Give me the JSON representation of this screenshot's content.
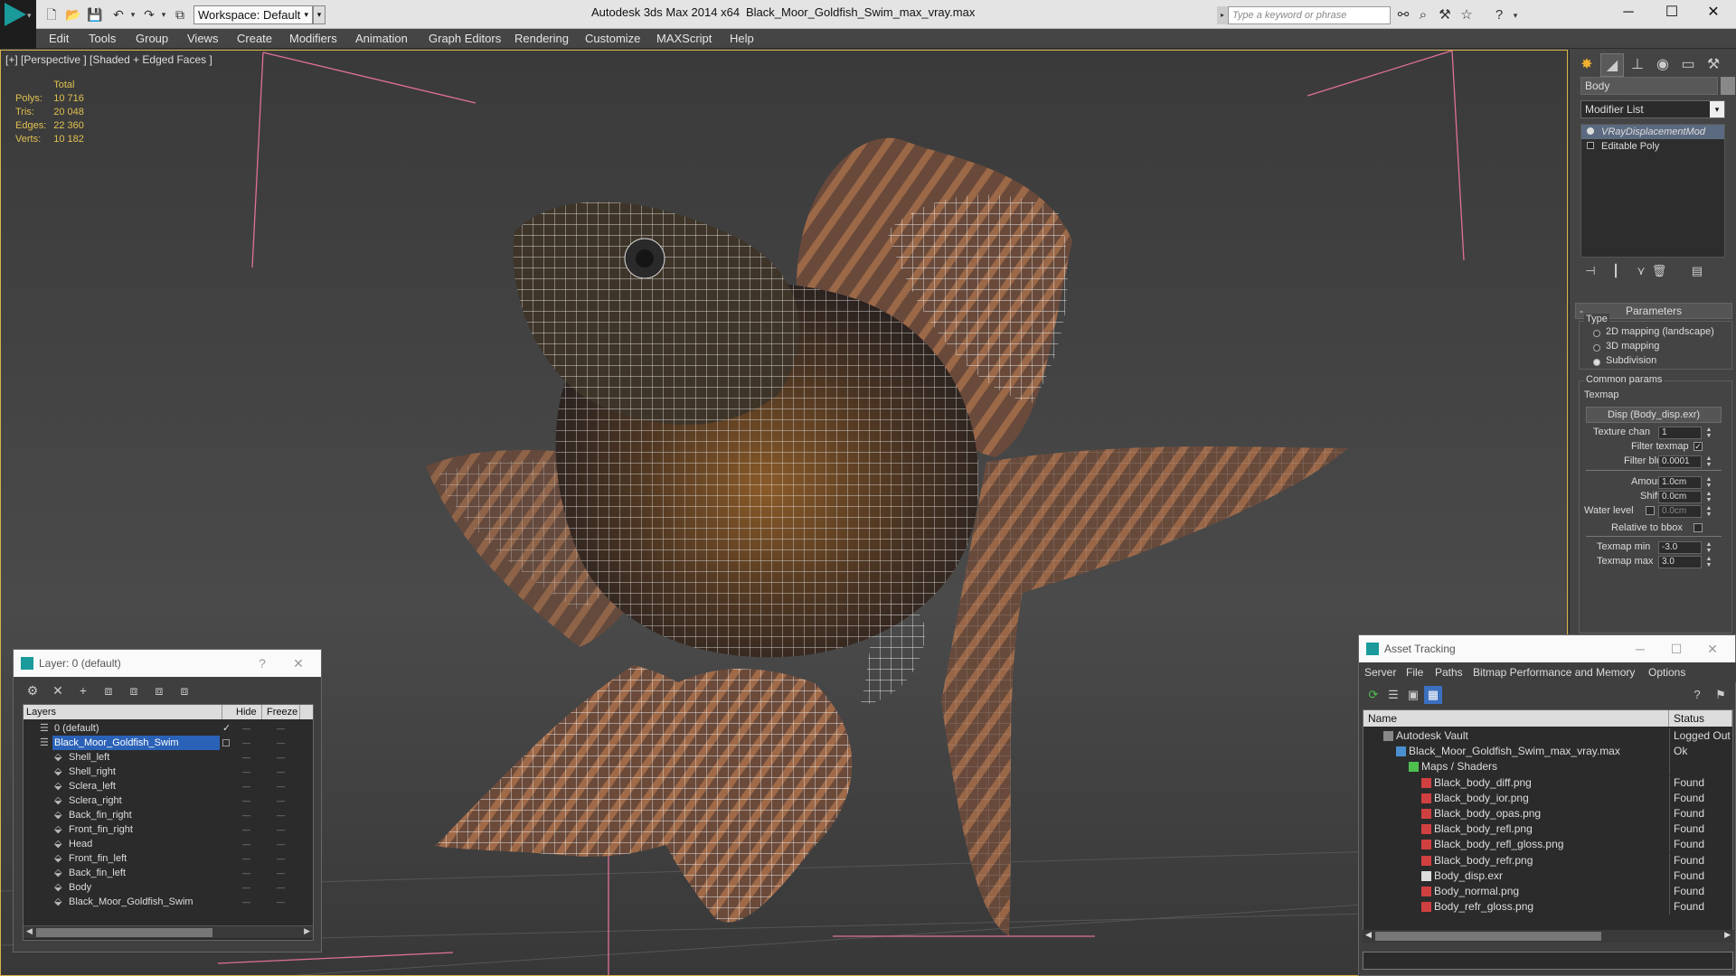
{
  "app": {
    "title": "Autodesk 3ds Max  2014 x64",
    "file": "Black_Moor_Goldfish_Swim_max_vray.max",
    "workspace": "Workspace: Default",
    "search_placeholder": "Type a keyword or phrase"
  },
  "menu": [
    "Edit",
    "Tools",
    "Group",
    "Views",
    "Create",
    "Modifiers",
    "Animation",
    "Graph Editors",
    "Rendering",
    "Customize",
    "MAXScript",
    "Help"
  ],
  "viewport": {
    "label": "[+] [Perspective ] [Shaded + Edged Faces ]",
    "stats": {
      "header": "Total",
      "rows": [
        {
          "label": "Polys:",
          "value": "10 716"
        },
        {
          "label": "Tris:",
          "value": "20 048"
        },
        {
          "label": "Edges:",
          "value": "22 360"
        },
        {
          "label": "Verts:",
          "value": "10 182"
        }
      ]
    }
  },
  "command_panel": {
    "object_name": "Body",
    "modifier_list": "Modifier List",
    "stack": [
      "VRayDisplacementMod",
      "Editable Poly"
    ],
    "rollout": "Parameters",
    "type_label": "Type",
    "types": [
      {
        "label": "2D mapping (landscape)",
        "on": false
      },
      {
        "label": "3D mapping",
        "on": false
      },
      {
        "label": "Subdivision",
        "on": true
      }
    ],
    "common_label": "Common params",
    "texmap_label": "Texmap",
    "texmap_button": "Disp (Body_disp.exr)",
    "texture_chan_label": "Texture chan",
    "texture_chan": "1",
    "filter_texmap_label": "Filter texmap",
    "filter_blur_label": "Filter blur",
    "filter_blur": "0.0001",
    "amount_label": "Amount",
    "amount": "1.0cm",
    "shift_label": "Shift",
    "shift": "0.0cm",
    "water_label": "Water level",
    "water": "0.0cm",
    "rel_bbox_label": "Relative to bbox",
    "texmap_min_label": "Texmap min",
    "texmap_min": "-3.0",
    "texmap_max_label": "Texmap max",
    "texmap_max": "3.0"
  },
  "layer_dialog": {
    "title": "Layer: 0 (default)",
    "help": "?",
    "close": "✕",
    "columns": [
      "Layers",
      "Hide",
      "Freeze"
    ],
    "rows": [
      {
        "name": "0 (default)",
        "indent": 0,
        "check": true
      },
      {
        "name": "Black_Moor_Goldfish_Swim",
        "indent": 0,
        "selected": true
      },
      {
        "name": "Shell_left",
        "indent": 1
      },
      {
        "name": "Shell_right",
        "indent": 1
      },
      {
        "name": "Sclera_left",
        "indent": 1
      },
      {
        "name": "Sclera_right",
        "indent": 1
      },
      {
        "name": "Back_fin_right",
        "indent": 1
      },
      {
        "name": "Front_fin_right",
        "indent": 1
      },
      {
        "name": "Head",
        "indent": 1
      },
      {
        "name": "Front_fin_left",
        "indent": 1
      },
      {
        "name": "Back_fin_left",
        "indent": 1
      },
      {
        "name": "Body",
        "indent": 1
      },
      {
        "name": "Black_Moor_Goldfish_Swim",
        "indent": 1
      }
    ]
  },
  "asset_tracking": {
    "title": "Asset Tracking",
    "menu": [
      "Server",
      "File",
      "Paths",
      "Bitmap Performance and Memory",
      "Options"
    ],
    "columns": [
      "Name",
      "Status"
    ],
    "rows": [
      {
        "name": "Autodesk Vault",
        "status": "Logged Out",
        "indent": 0
      },
      {
        "name": "Black_Moor_Goldfish_Swim_max_vray.max",
        "status": "Ok",
        "indent": 1
      },
      {
        "name": "Maps / Shaders",
        "status": "",
        "indent": 2
      },
      {
        "name": "Black_body_diff.png",
        "status": "Found",
        "indent": 3
      },
      {
        "name": "Black_body_ior.png",
        "status": "Found",
        "indent": 3
      },
      {
        "name": "Black_body_opas.png",
        "status": "Found",
        "indent": 3
      },
      {
        "name": "Black_body_refl.png",
        "status": "Found",
        "indent": 3
      },
      {
        "name": "Black_body_refl_gloss.png",
        "status": "Found",
        "indent": 3
      },
      {
        "name": "Black_body_refr.png",
        "status": "Found",
        "indent": 3
      },
      {
        "name": "Body_disp.exr",
        "status": "Found",
        "indent": 3
      },
      {
        "name": "Body_normal.png",
        "status": "Found",
        "indent": 3
      },
      {
        "name": "Body_refr_gloss.png",
        "status": "Found",
        "indent": 3
      }
    ]
  },
  "colors": {
    "accent": "#1a9a9a",
    "selection": "#2a62b8",
    "stats": "#e0c050"
  }
}
